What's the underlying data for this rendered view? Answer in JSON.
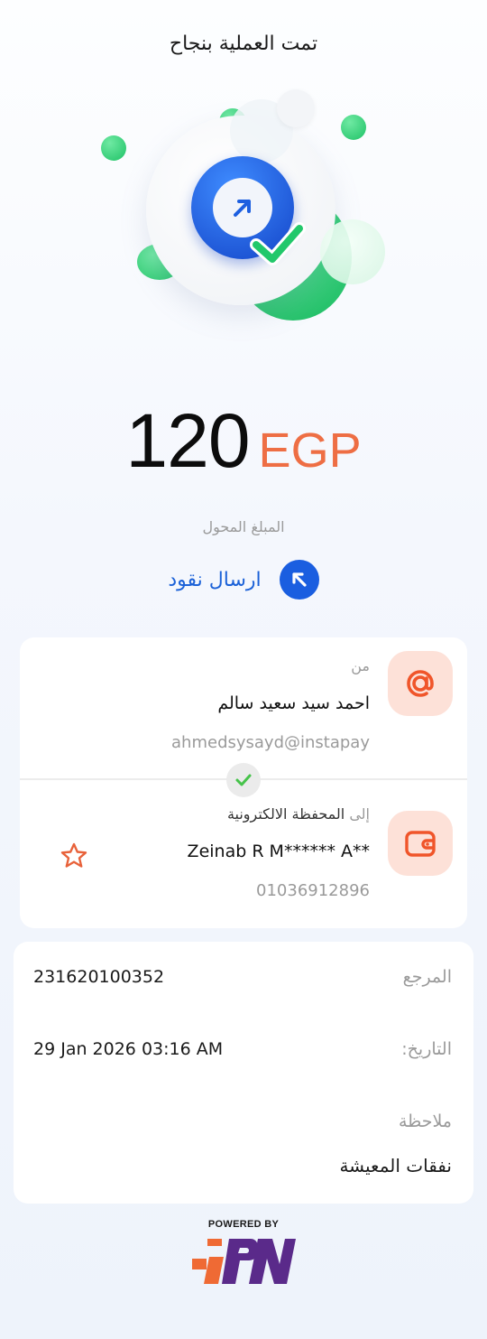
{
  "header": {
    "title": "تمت العملية بنجاح"
  },
  "icons": {
    "hero": "send-money-success-illustration",
    "type": "arrow-up-left-icon",
    "sender": "at-sign-icon",
    "receiver": "wallet-icon",
    "verified": "check-icon",
    "favorite": "star-icon"
  },
  "amount": {
    "value": "120",
    "currency": "EGP",
    "label": "المبلغ المحول"
  },
  "transaction_type": {
    "label": "ارسال نقود"
  },
  "sender": {
    "label": "من",
    "name": "احمد سيد سعيد سالم",
    "address": "ahmedsysayd@instapay"
  },
  "receiver": {
    "label_prefix": "إلى",
    "label_type": "المحفظة الالكترونية",
    "name": "Zeinab R M****** A**",
    "phone": "01036912896"
  },
  "details": {
    "reference_label": "المرجع",
    "reference_value": "231620100352",
    "date_label": "التاريخ:",
    "date_value": "29 Jan 2026 03:16 AM",
    "note_label": "ملاحظة",
    "note_value": "نفقات المعيشة"
  },
  "footer": {
    "powered_by": "POWERED BY",
    "brand": "IPN"
  },
  "colors": {
    "accent_blue": "#1a5ee0",
    "accent_orange": "#ee6e44",
    "success_green": "#22c86b",
    "icon_bg": "#fde1d8"
  }
}
